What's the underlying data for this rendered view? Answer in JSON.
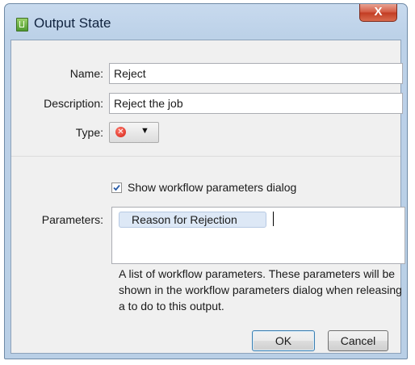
{
  "window": {
    "title": "Output State",
    "close_label": "X"
  },
  "form": {
    "name_label": "Name:",
    "name_value": "Reject",
    "description_label": "Description:",
    "description_value": "Reject the job",
    "type_label": "Type:",
    "type_icon": "reject-icon",
    "show_params_label": "Show workflow parameters dialog",
    "show_params_checked": true,
    "parameters_label": "Parameters:",
    "parameters": [
      "Reason for Rejection"
    ],
    "help_text": "A list of workflow parameters. These parameters will be shown in the workflow parameters dialog when releasing a to do to this output."
  },
  "buttons": {
    "ok_label": "OK",
    "cancel_label": "Cancel"
  },
  "colors": {
    "accent": "#3c7fb1",
    "reject": "#d41f12",
    "frame": "#bcd1e8"
  }
}
